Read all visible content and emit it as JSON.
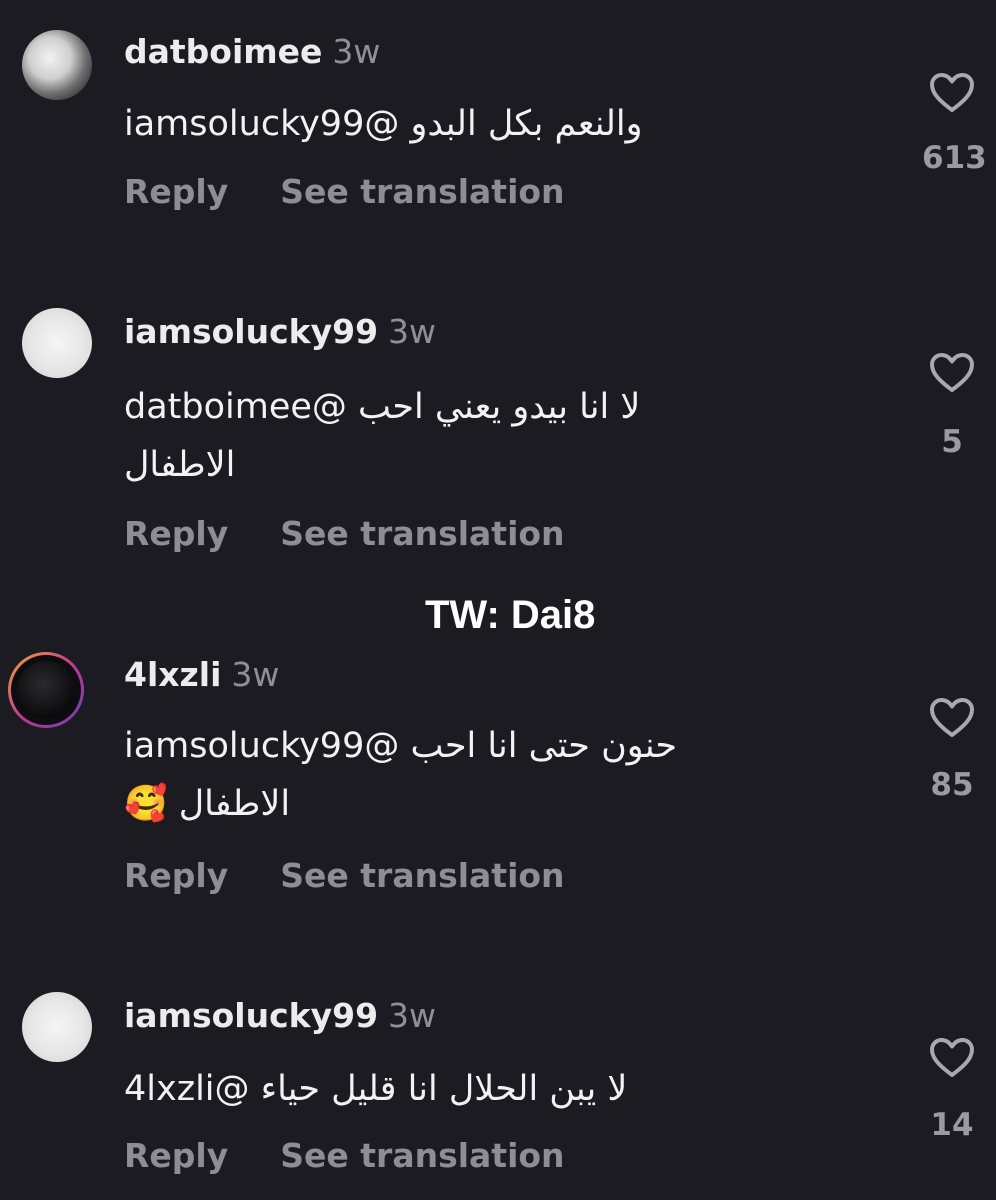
{
  "watermark": "TW: Dai8",
  "comments": [
    {
      "username": "datboimee",
      "time": "3w",
      "text": "والنعم بكل البدو @iamsolucky99",
      "reply_label": "Reply",
      "translate_label": "See translation",
      "likes": "613",
      "avatar": "photo"
    },
    {
      "username": "iamsolucky99",
      "time": "3w",
      "text": "لا انا بيدو يعني احب @datboimee\nالاطفال",
      "reply_label": "Reply",
      "translate_label": "See translation",
      "likes": "5",
      "avatar": "default"
    },
    {
      "username": "4lxzli",
      "time": "3w",
      "text": "حنون حتى انا احب @iamsolucky99\nالاطفال 🥰",
      "reply_label": "Reply",
      "translate_label": "See translation",
      "likes": "85",
      "avatar": "story-ring"
    },
    {
      "username": "iamsolucky99",
      "time": "3w",
      "text": "لا يبن الحلال انا قليل حياء @4lxzli",
      "reply_label": "Reply",
      "translate_label": "See translation",
      "likes": "14",
      "avatar": "default"
    }
  ],
  "icons": {
    "like": "heart-outline-icon"
  },
  "colors": {
    "background": "#1c1b22",
    "muted_text": "#8d8d92"
  }
}
